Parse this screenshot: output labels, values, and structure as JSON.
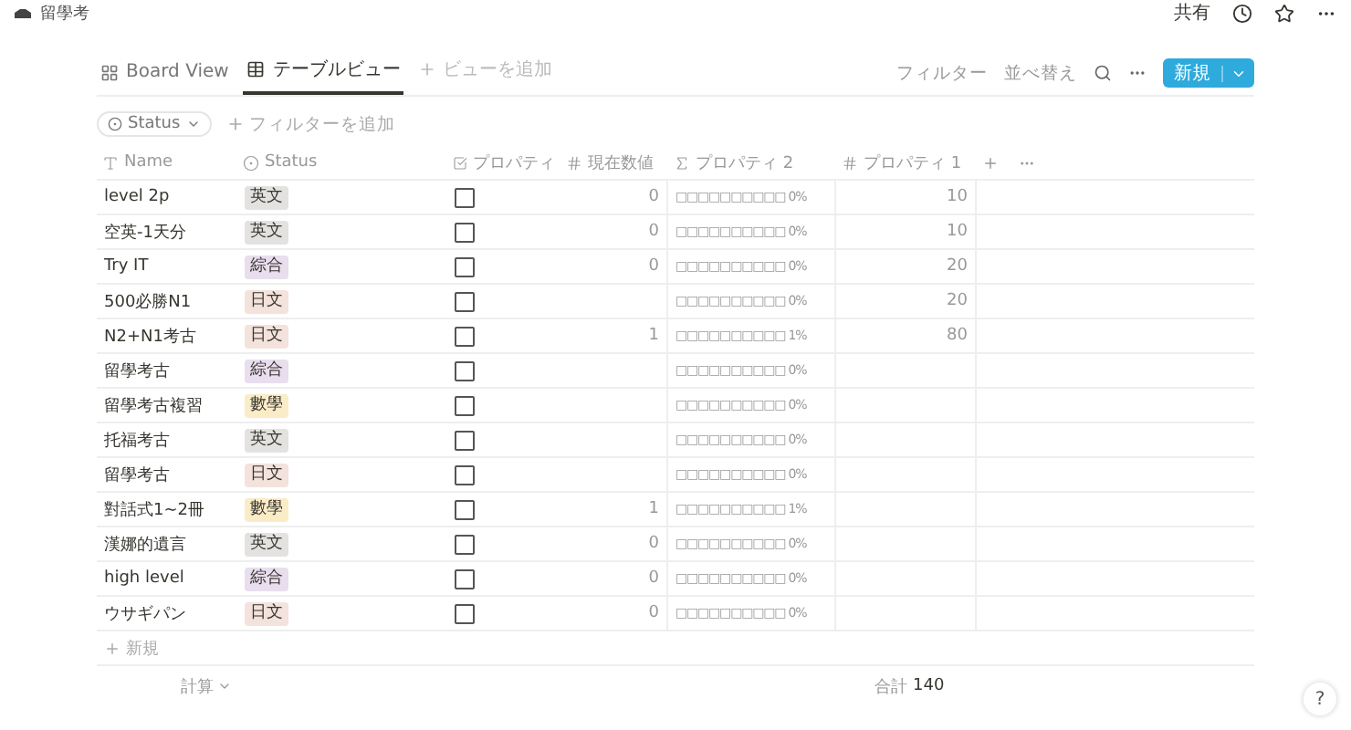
{
  "breadcrumb": "留學考",
  "topbar_actions": {
    "share": "共有"
  },
  "tabs": [
    {
      "label": "Board View",
      "kind": "board",
      "selected": false
    },
    {
      "label": "テーブルビュー",
      "kind": "table",
      "selected": true
    }
  ],
  "add_view": "ビューを追加",
  "toolbar": {
    "filter": "フィルター",
    "sort": "並べ替え",
    "new_button": "新規"
  },
  "filters": {
    "chip": "Status",
    "add": "フィルターを追加"
  },
  "columns": [
    {
      "label": "Name",
      "kind": "title"
    },
    {
      "label": "Status",
      "kind": "status"
    },
    {
      "label": "プロパティ",
      "kind": "checkbox"
    },
    {
      "label": "現在数値",
      "kind": "number"
    },
    {
      "label": "プロパティ 2",
      "kind": "formula"
    },
    {
      "label": "プロパティ 1",
      "kind": "number"
    }
  ],
  "rows": [
    {
      "name": "level 2p",
      "status": "英文",
      "color": "#e3e2e0",
      "checked": false,
      "current": "0",
      "progress": "□□□□□□□□□□ 0%",
      "target": "10"
    },
    {
      "name": "空英-1天分",
      "status": "英文",
      "color": "#e3e2e0",
      "checked": false,
      "current": "0",
      "progress": "□□□□□□□□□□ 0%",
      "target": "10"
    },
    {
      "name": "Try IT",
      "status": "綜合",
      "color": "#e8deee",
      "checked": false,
      "current": "0",
      "progress": "□□□□□□□□□□ 0%",
      "target": "20"
    },
    {
      "name": "500必勝N1",
      "status": "日文",
      "color": "#f4e2dc",
      "checked": false,
      "current": "",
      "progress": "□□□□□□□□□□ 0%",
      "target": "20"
    },
    {
      "name": "N2+N1考古",
      "status": "日文",
      "color": "#f4e2dc",
      "checked": false,
      "current": "1",
      "progress": "□□□□□□□□□□ 1%",
      "target": "80"
    },
    {
      "name": "留學考古",
      "status": "綜合",
      "color": "#e8deee",
      "checked": false,
      "current": "",
      "progress": "□□□□□□□□□□ 0%",
      "target": ""
    },
    {
      "name": "留學考古複習",
      "status": "數學",
      "color": "#fbecc8",
      "checked": false,
      "current": "",
      "progress": "□□□□□□□□□□ 0%",
      "target": ""
    },
    {
      "name": "托福考古",
      "status": "英文",
      "color": "#e3e2e0",
      "checked": false,
      "current": "",
      "progress": "□□□□□□□□□□ 0%",
      "target": ""
    },
    {
      "name": "留學考古",
      "status": "日文",
      "color": "#f4e2dc",
      "checked": false,
      "current": "",
      "progress": "□□□□□□□□□□ 0%",
      "target": ""
    },
    {
      "name": "對話式1~2冊",
      "status": "數學",
      "color": "#fbecc8",
      "checked": false,
      "current": "1",
      "progress": "□□□□□□□□□□ 1%",
      "target": ""
    },
    {
      "name": "漢娜的遺言",
      "status": "英文",
      "color": "#e3e2e0",
      "checked": false,
      "current": "0",
      "progress": "□□□□□□□□□□ 0%",
      "target": ""
    },
    {
      "name": "high level",
      "status": "綜合",
      "color": "#e8deee",
      "checked": false,
      "current": "0",
      "progress": "□□□□□□□□□□ 0%",
      "target": ""
    },
    {
      "name": "ウサギパン",
      "status": "日文",
      "color": "#f4e2dc",
      "checked": false,
      "current": "0",
      "progress": "□□□□□□□□□□ 0%",
      "target": ""
    }
  ],
  "new_row": "新規",
  "footer": {
    "calculate": "計算",
    "sum_label": "合計",
    "sum_value": "140"
  },
  "help": "?"
}
